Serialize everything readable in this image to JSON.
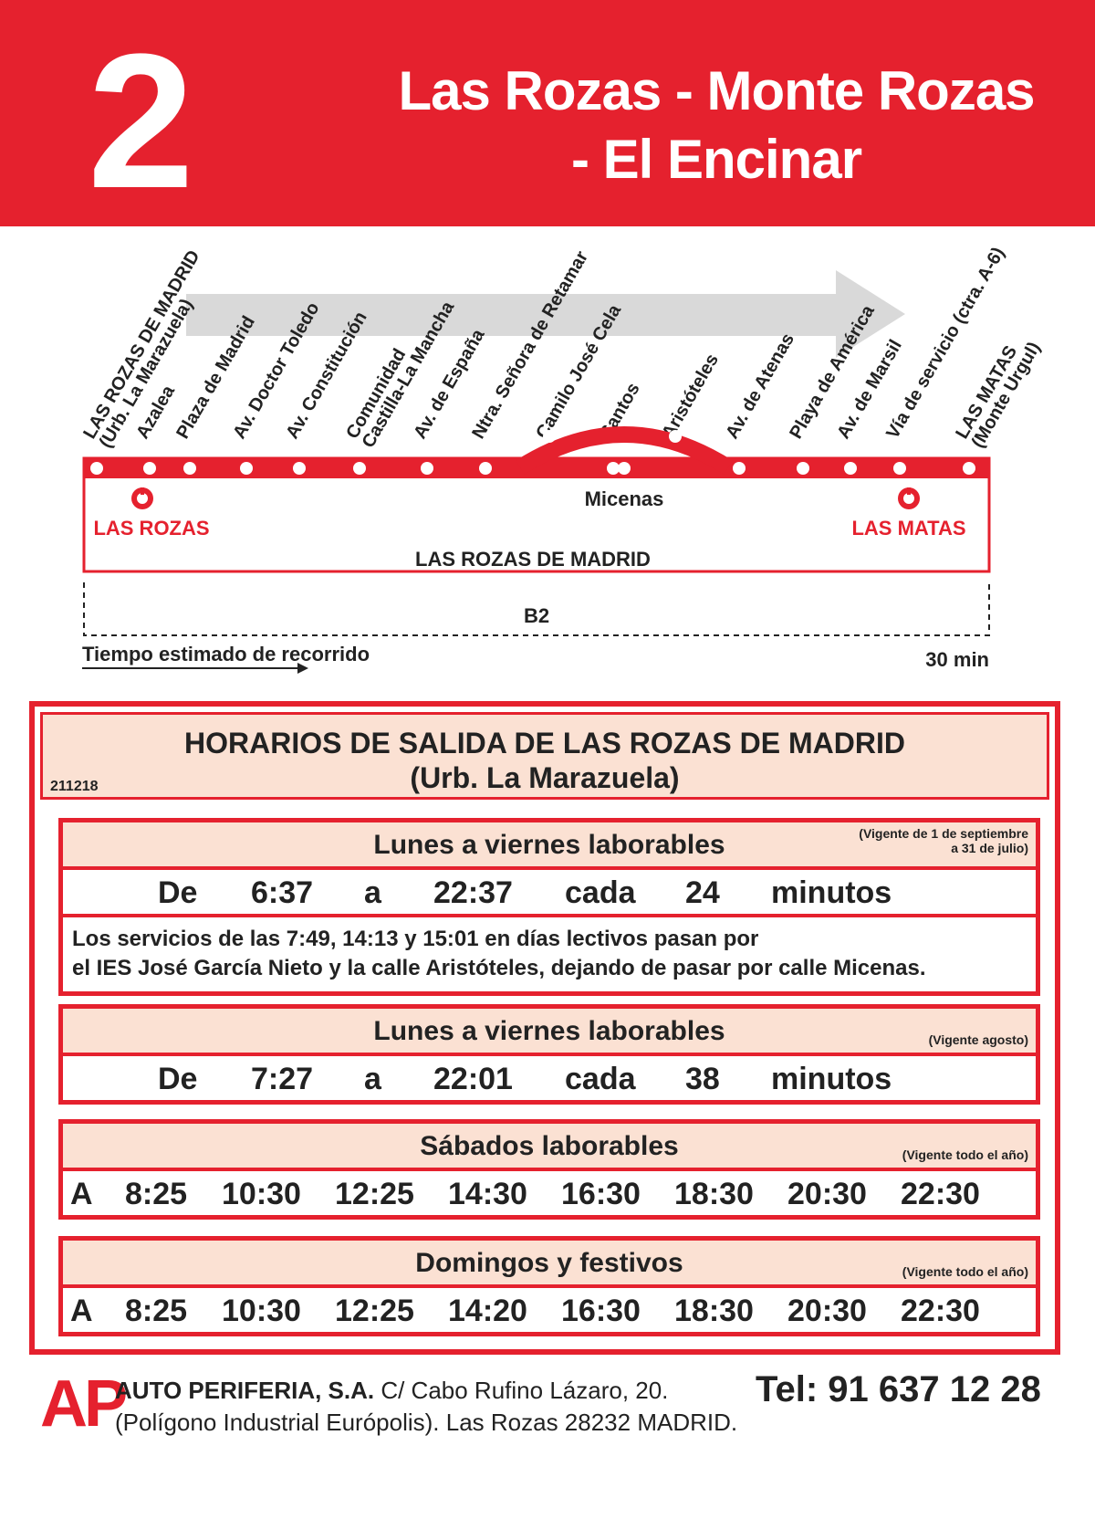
{
  "header": {
    "route_number": "2",
    "title_line1": "Las Rozas - Monte Rozas",
    "title_line2": "- El Encinar"
  },
  "route": {
    "stops": [
      "LAS ROZAS DE MADRID|(Urb. La Marazuela)",
      "Azalea",
      "Plaza de Madrid",
      "Av. Doctor Toledo",
      "Av. Constitución",
      "Comunidad|Castilla-La Mancha",
      "Av. de España",
      "Ntra. Señora de Retamar",
      "Camilo José Cela",
      "Santos",
      "Aristóteles",
      "Av. de Atenas",
      "Playa de América",
      "Av. de Marsil",
      "Vía de servicio (ctra. A-6)",
      "LAS MATAS|(Monte Urgul)"
    ],
    "branch_label": "Micenas",
    "left_place": "LAS ROZAS",
    "right_place": "LAS MATAS",
    "town": "LAS ROZAS DE MADRID",
    "zone": "B2",
    "time_label": "Tiempo estimado de recorrido",
    "time_value": "30 min"
  },
  "schedule": {
    "title_line1": "HORARIOS DE SALIDA DE LAS ROZAS DE MADRID",
    "title_line2": "(Urb. La Marazuela)",
    "doc_code": "211218",
    "weekday1": {
      "title": "Lunes a viernes laborables",
      "note1": "(Vigente de 1 de septiembre",
      "note2": "a 31 de julio)",
      "row": [
        "De",
        "6:37",
        "a",
        "22:37",
        "cada",
        "24",
        "minutos"
      ],
      "notice1": "Los servicios de las 7:49, 14:13 y 15:01 en días lectivos pasan por",
      "notice2": "el IES José García Nieto y la calle Aristóteles, dejando de pasar por calle Micenas."
    },
    "weekday2": {
      "title": "Lunes a viernes laborables",
      "note": "(Vigente agosto)",
      "row": [
        "De",
        "7:27",
        "a",
        "22:01",
        "cada",
        "38",
        "minutos"
      ]
    },
    "saturday": {
      "title": "Sábados laborables",
      "note": "(Vigente todo el año)",
      "row": [
        "A",
        "8:25",
        "10:30",
        "12:25",
        "14:30",
        "16:30",
        "18:30",
        "20:30",
        "22:30"
      ]
    },
    "sunday": {
      "title": "Domingos y festivos",
      "note": "(Vigente todo el año)",
      "row": [
        "A",
        "8:25",
        "10:30",
        "12:25",
        "14:20",
        "16:30",
        "18:30",
        "20:30",
        "22:30"
      ]
    }
  },
  "footer": {
    "logo": "AP",
    "company_name": "AUTO PERIFERIA, S.A.",
    "address1": " C/ Cabo Rufino Lázaro, 20.",
    "address2": "(Polígono Industrial Európolis). Las Rozas 28232 MADRID.",
    "phone": "Tel: 91 637 12 28"
  },
  "colors": {
    "brand_red": "#e5212e",
    "header_fill": "#fbe1d3",
    "arrow_grey": "#d9d9d9"
  },
  "icons": {
    "station": "metro-station-icon"
  }
}
